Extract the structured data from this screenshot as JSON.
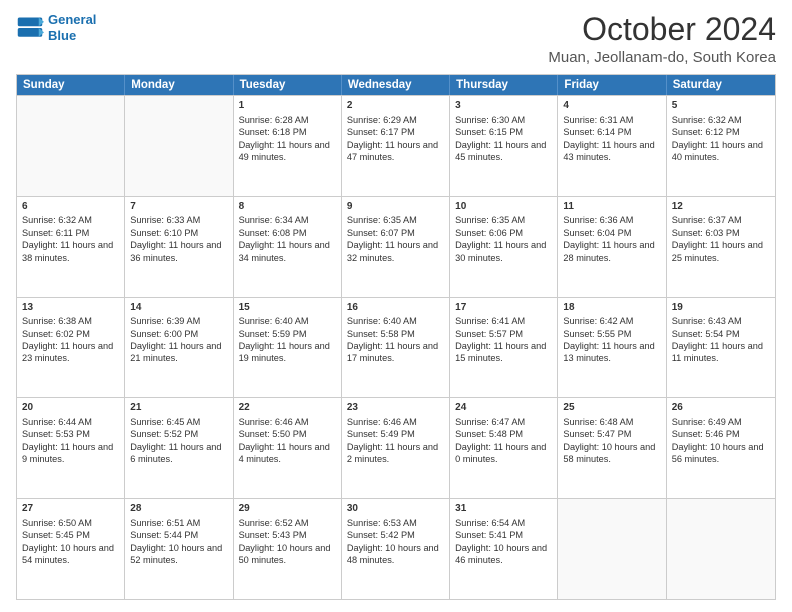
{
  "header": {
    "logo_line1": "General",
    "logo_line2": "Blue",
    "title": "October 2024",
    "subtitle": "Muan, Jeollanam-do, South Korea"
  },
  "weekdays": [
    "Sunday",
    "Monday",
    "Tuesday",
    "Wednesday",
    "Thursday",
    "Friday",
    "Saturday"
  ],
  "weeks": [
    [
      {
        "date": "",
        "sunrise": "",
        "sunset": "",
        "daylight": ""
      },
      {
        "date": "",
        "sunrise": "",
        "sunset": "",
        "daylight": ""
      },
      {
        "date": "1",
        "sunrise": "Sunrise: 6:28 AM",
        "sunset": "Sunset: 6:18 PM",
        "daylight": "Daylight: 11 hours and 49 minutes."
      },
      {
        "date": "2",
        "sunrise": "Sunrise: 6:29 AM",
        "sunset": "Sunset: 6:17 PM",
        "daylight": "Daylight: 11 hours and 47 minutes."
      },
      {
        "date": "3",
        "sunrise": "Sunrise: 6:30 AM",
        "sunset": "Sunset: 6:15 PM",
        "daylight": "Daylight: 11 hours and 45 minutes."
      },
      {
        "date": "4",
        "sunrise": "Sunrise: 6:31 AM",
        "sunset": "Sunset: 6:14 PM",
        "daylight": "Daylight: 11 hours and 43 minutes."
      },
      {
        "date": "5",
        "sunrise": "Sunrise: 6:32 AM",
        "sunset": "Sunset: 6:12 PM",
        "daylight": "Daylight: 11 hours and 40 minutes."
      }
    ],
    [
      {
        "date": "6",
        "sunrise": "Sunrise: 6:32 AM",
        "sunset": "Sunset: 6:11 PM",
        "daylight": "Daylight: 11 hours and 38 minutes."
      },
      {
        "date": "7",
        "sunrise": "Sunrise: 6:33 AM",
        "sunset": "Sunset: 6:10 PM",
        "daylight": "Daylight: 11 hours and 36 minutes."
      },
      {
        "date": "8",
        "sunrise": "Sunrise: 6:34 AM",
        "sunset": "Sunset: 6:08 PM",
        "daylight": "Daylight: 11 hours and 34 minutes."
      },
      {
        "date": "9",
        "sunrise": "Sunrise: 6:35 AM",
        "sunset": "Sunset: 6:07 PM",
        "daylight": "Daylight: 11 hours and 32 minutes."
      },
      {
        "date": "10",
        "sunrise": "Sunrise: 6:35 AM",
        "sunset": "Sunset: 6:06 PM",
        "daylight": "Daylight: 11 hours and 30 minutes."
      },
      {
        "date": "11",
        "sunrise": "Sunrise: 6:36 AM",
        "sunset": "Sunset: 6:04 PM",
        "daylight": "Daylight: 11 hours and 28 minutes."
      },
      {
        "date": "12",
        "sunrise": "Sunrise: 6:37 AM",
        "sunset": "Sunset: 6:03 PM",
        "daylight": "Daylight: 11 hours and 25 minutes."
      }
    ],
    [
      {
        "date": "13",
        "sunrise": "Sunrise: 6:38 AM",
        "sunset": "Sunset: 6:02 PM",
        "daylight": "Daylight: 11 hours and 23 minutes."
      },
      {
        "date": "14",
        "sunrise": "Sunrise: 6:39 AM",
        "sunset": "Sunset: 6:00 PM",
        "daylight": "Daylight: 11 hours and 21 minutes."
      },
      {
        "date": "15",
        "sunrise": "Sunrise: 6:40 AM",
        "sunset": "Sunset: 5:59 PM",
        "daylight": "Daylight: 11 hours and 19 minutes."
      },
      {
        "date": "16",
        "sunrise": "Sunrise: 6:40 AM",
        "sunset": "Sunset: 5:58 PM",
        "daylight": "Daylight: 11 hours and 17 minutes."
      },
      {
        "date": "17",
        "sunrise": "Sunrise: 6:41 AM",
        "sunset": "Sunset: 5:57 PM",
        "daylight": "Daylight: 11 hours and 15 minutes."
      },
      {
        "date": "18",
        "sunrise": "Sunrise: 6:42 AM",
        "sunset": "Sunset: 5:55 PM",
        "daylight": "Daylight: 11 hours and 13 minutes."
      },
      {
        "date": "19",
        "sunrise": "Sunrise: 6:43 AM",
        "sunset": "Sunset: 5:54 PM",
        "daylight": "Daylight: 11 hours and 11 minutes."
      }
    ],
    [
      {
        "date": "20",
        "sunrise": "Sunrise: 6:44 AM",
        "sunset": "Sunset: 5:53 PM",
        "daylight": "Daylight: 11 hours and 9 minutes."
      },
      {
        "date": "21",
        "sunrise": "Sunrise: 6:45 AM",
        "sunset": "Sunset: 5:52 PM",
        "daylight": "Daylight: 11 hours and 6 minutes."
      },
      {
        "date": "22",
        "sunrise": "Sunrise: 6:46 AM",
        "sunset": "Sunset: 5:50 PM",
        "daylight": "Daylight: 11 hours and 4 minutes."
      },
      {
        "date": "23",
        "sunrise": "Sunrise: 6:46 AM",
        "sunset": "Sunset: 5:49 PM",
        "daylight": "Daylight: 11 hours and 2 minutes."
      },
      {
        "date": "24",
        "sunrise": "Sunrise: 6:47 AM",
        "sunset": "Sunset: 5:48 PM",
        "daylight": "Daylight: 11 hours and 0 minutes."
      },
      {
        "date": "25",
        "sunrise": "Sunrise: 6:48 AM",
        "sunset": "Sunset: 5:47 PM",
        "daylight": "Daylight: 10 hours and 58 minutes."
      },
      {
        "date": "26",
        "sunrise": "Sunrise: 6:49 AM",
        "sunset": "Sunset: 5:46 PM",
        "daylight": "Daylight: 10 hours and 56 minutes."
      }
    ],
    [
      {
        "date": "27",
        "sunrise": "Sunrise: 6:50 AM",
        "sunset": "Sunset: 5:45 PM",
        "daylight": "Daylight: 10 hours and 54 minutes."
      },
      {
        "date": "28",
        "sunrise": "Sunrise: 6:51 AM",
        "sunset": "Sunset: 5:44 PM",
        "daylight": "Daylight: 10 hours and 52 minutes."
      },
      {
        "date": "29",
        "sunrise": "Sunrise: 6:52 AM",
        "sunset": "Sunset: 5:43 PM",
        "daylight": "Daylight: 10 hours and 50 minutes."
      },
      {
        "date": "30",
        "sunrise": "Sunrise: 6:53 AM",
        "sunset": "Sunset: 5:42 PM",
        "daylight": "Daylight: 10 hours and 48 minutes."
      },
      {
        "date": "31",
        "sunrise": "Sunrise: 6:54 AM",
        "sunset": "Sunset: 5:41 PM",
        "daylight": "Daylight: 10 hours and 46 minutes."
      },
      {
        "date": "",
        "sunrise": "",
        "sunset": "",
        "daylight": ""
      },
      {
        "date": "",
        "sunrise": "",
        "sunset": "",
        "daylight": ""
      }
    ]
  ]
}
